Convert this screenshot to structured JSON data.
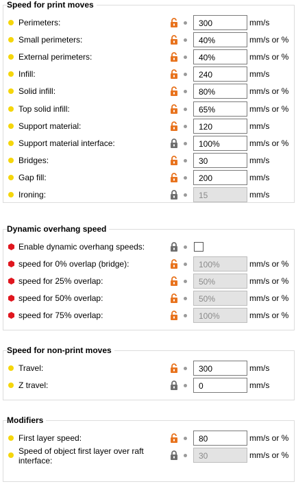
{
  "colors": {
    "accent_orange": "#e8731e",
    "lock_gray": "#6e6e6e",
    "dot_yellow": "#f5d60b",
    "hex_red": "#e0161e"
  },
  "sections": [
    {
      "title": "Speed for print moves",
      "rows": [
        {
          "label": "Perimeters:",
          "marker": "yellow-dot",
          "lock": "unlocked",
          "value": "300",
          "unit": "mm/s",
          "enabled": true
        },
        {
          "label": "Small perimeters:",
          "marker": "yellow-dot",
          "lock": "unlocked",
          "value": "40%",
          "unit": "mm/s or %",
          "enabled": true
        },
        {
          "label": "External perimeters:",
          "marker": "yellow-dot",
          "lock": "unlocked",
          "value": "40%",
          "unit": "mm/s or %",
          "enabled": true
        },
        {
          "label": "Infill:",
          "marker": "yellow-dot",
          "lock": "unlocked",
          "value": "240",
          "unit": "mm/s",
          "enabled": true
        },
        {
          "label": "Solid infill:",
          "marker": "yellow-dot",
          "lock": "unlocked",
          "value": "80%",
          "unit": "mm/s or %",
          "enabled": true
        },
        {
          "label": "Top solid infill:",
          "marker": "yellow-dot",
          "lock": "unlocked",
          "value": "65%",
          "unit": "mm/s or %",
          "enabled": true
        },
        {
          "label": "Support material:",
          "marker": "yellow-dot",
          "lock": "unlocked",
          "value": "120",
          "unit": "mm/s",
          "enabled": true
        },
        {
          "label": "Support material interface:",
          "marker": "yellow-dot",
          "lock": "locked",
          "value": "100%",
          "unit": "mm/s or %",
          "enabled": true
        },
        {
          "label": "Bridges:",
          "marker": "yellow-dot",
          "lock": "unlocked",
          "value": "30",
          "unit": "mm/s",
          "enabled": true
        },
        {
          "label": "Gap fill:",
          "marker": "yellow-dot",
          "lock": "unlocked",
          "value": "200",
          "unit": "mm/s",
          "enabled": true
        },
        {
          "label": "Ironing:",
          "marker": "yellow-dot",
          "lock": "locked",
          "value": "15",
          "unit": "mm/s",
          "enabled": false
        }
      ]
    },
    {
      "title": "Dynamic overhang speed",
      "rows": [
        {
          "label": "Enable dynamic overhang speeds:",
          "marker": "red-hex",
          "lock": "locked",
          "checkbox": true,
          "checked": false
        },
        {
          "label": "speed for 0% overlap (bridge):",
          "marker": "red-hex",
          "lock": "unlocked",
          "value": "100%",
          "unit": "mm/s or %",
          "enabled": false
        },
        {
          "label": "speed for 25% overlap:",
          "marker": "red-hex",
          "lock": "unlocked",
          "value": "50%",
          "unit": "mm/s or %",
          "enabled": false
        },
        {
          "label": "speed for 50% overlap:",
          "marker": "red-hex",
          "lock": "unlocked",
          "value": "50%",
          "unit": "mm/s or %",
          "enabled": false
        },
        {
          "label": "speed for 75% overlap:",
          "marker": "red-hex",
          "lock": "unlocked",
          "value": "100%",
          "unit": "mm/s or %",
          "enabled": false
        }
      ]
    },
    {
      "title": "Speed for non-print moves",
      "rows": [
        {
          "label": "Travel:",
          "marker": "yellow-dot",
          "lock": "unlocked",
          "value": "300",
          "unit": "mm/s",
          "enabled": true
        },
        {
          "label": "Z travel:",
          "marker": "yellow-dot",
          "lock": "locked",
          "value": "0",
          "unit": "mm/s",
          "enabled": true
        }
      ]
    },
    {
      "title": "Modifiers",
      "rows": [
        {
          "label": "First layer speed:",
          "marker": "yellow-dot",
          "lock": "unlocked",
          "value": "80",
          "unit": "mm/s or %",
          "enabled": true
        },
        {
          "label": "Speed of object first layer over raft interface:",
          "marker": "yellow-dot",
          "lock": "locked",
          "value": "30",
          "unit": "mm/s or %",
          "enabled": false,
          "two_line": true
        }
      ]
    }
  ]
}
